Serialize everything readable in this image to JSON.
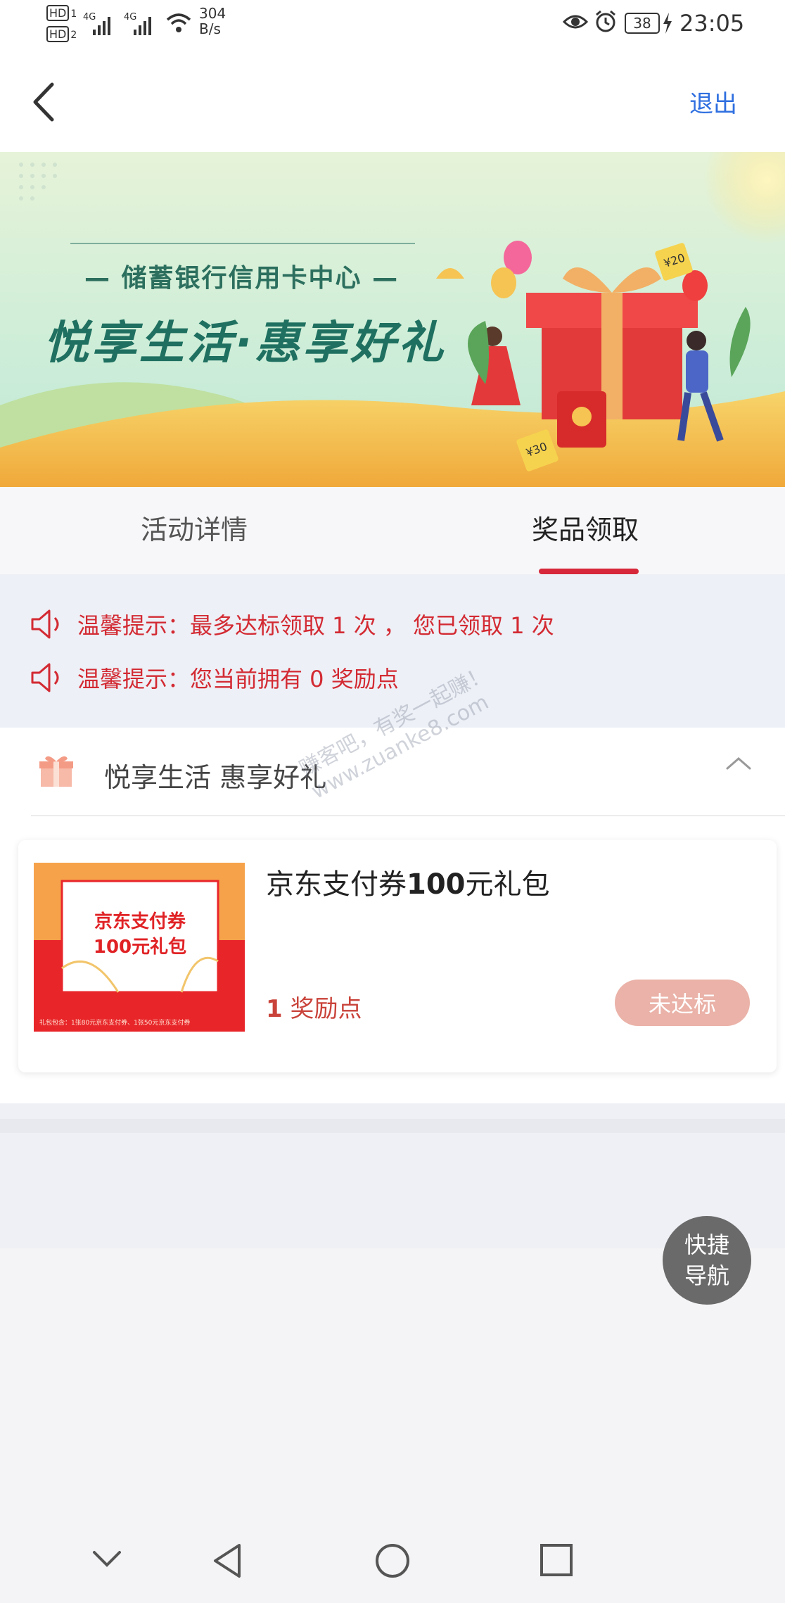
{
  "status_bar": {
    "hd1": "HD",
    "hd1_sub": "1",
    "hd2": "HD",
    "hd2_sub": "2",
    "net1": "4G",
    "net2": "4G",
    "speed_value": "304",
    "speed_unit": "B/s",
    "battery": "38",
    "time": "23:05"
  },
  "header": {
    "exit_label": "退出"
  },
  "banner": {
    "subtitle": "— 储蓄银行信用卡中心 —",
    "title": "悦享生活·惠享好礼",
    "coupon_a": "¥20",
    "coupon_b": "¥30"
  },
  "tabs": [
    {
      "label": "活动详情",
      "active": false
    },
    {
      "label": "奖品领取",
      "active": true
    }
  ],
  "notices": [
    {
      "text": "温馨提示：最多达标领取 1 次 ， 您已领取 1 次"
    },
    {
      "text": "温馨提示：您当前拥有 0 奖励点"
    }
  ],
  "section": {
    "title": "悦享生活 惠享好礼",
    "expanded": true
  },
  "prize_card": {
    "title_prefix": "京东支付券",
    "title_amount": "100",
    "title_suffix": "元礼包",
    "image_line1": "京东支付券",
    "image_line2": "100元礼包",
    "image_footnote": "礼包包含：1张80元京东支付券、1张50元京东支付券",
    "points_value": "1",
    "points_unit": "奖励点",
    "button_label": "未达标"
  },
  "fab": {
    "line1": "快捷",
    "line2": "导航"
  },
  "watermark": {
    "line1": "赚客吧，有奖一起赚！",
    "line2": "www.zuanke8.com"
  },
  "colors": {
    "accent_red": "#d6283a",
    "notice_red": "#d32a33",
    "link_blue": "#2f6fe0",
    "disabled_button": "#eab2a8"
  }
}
